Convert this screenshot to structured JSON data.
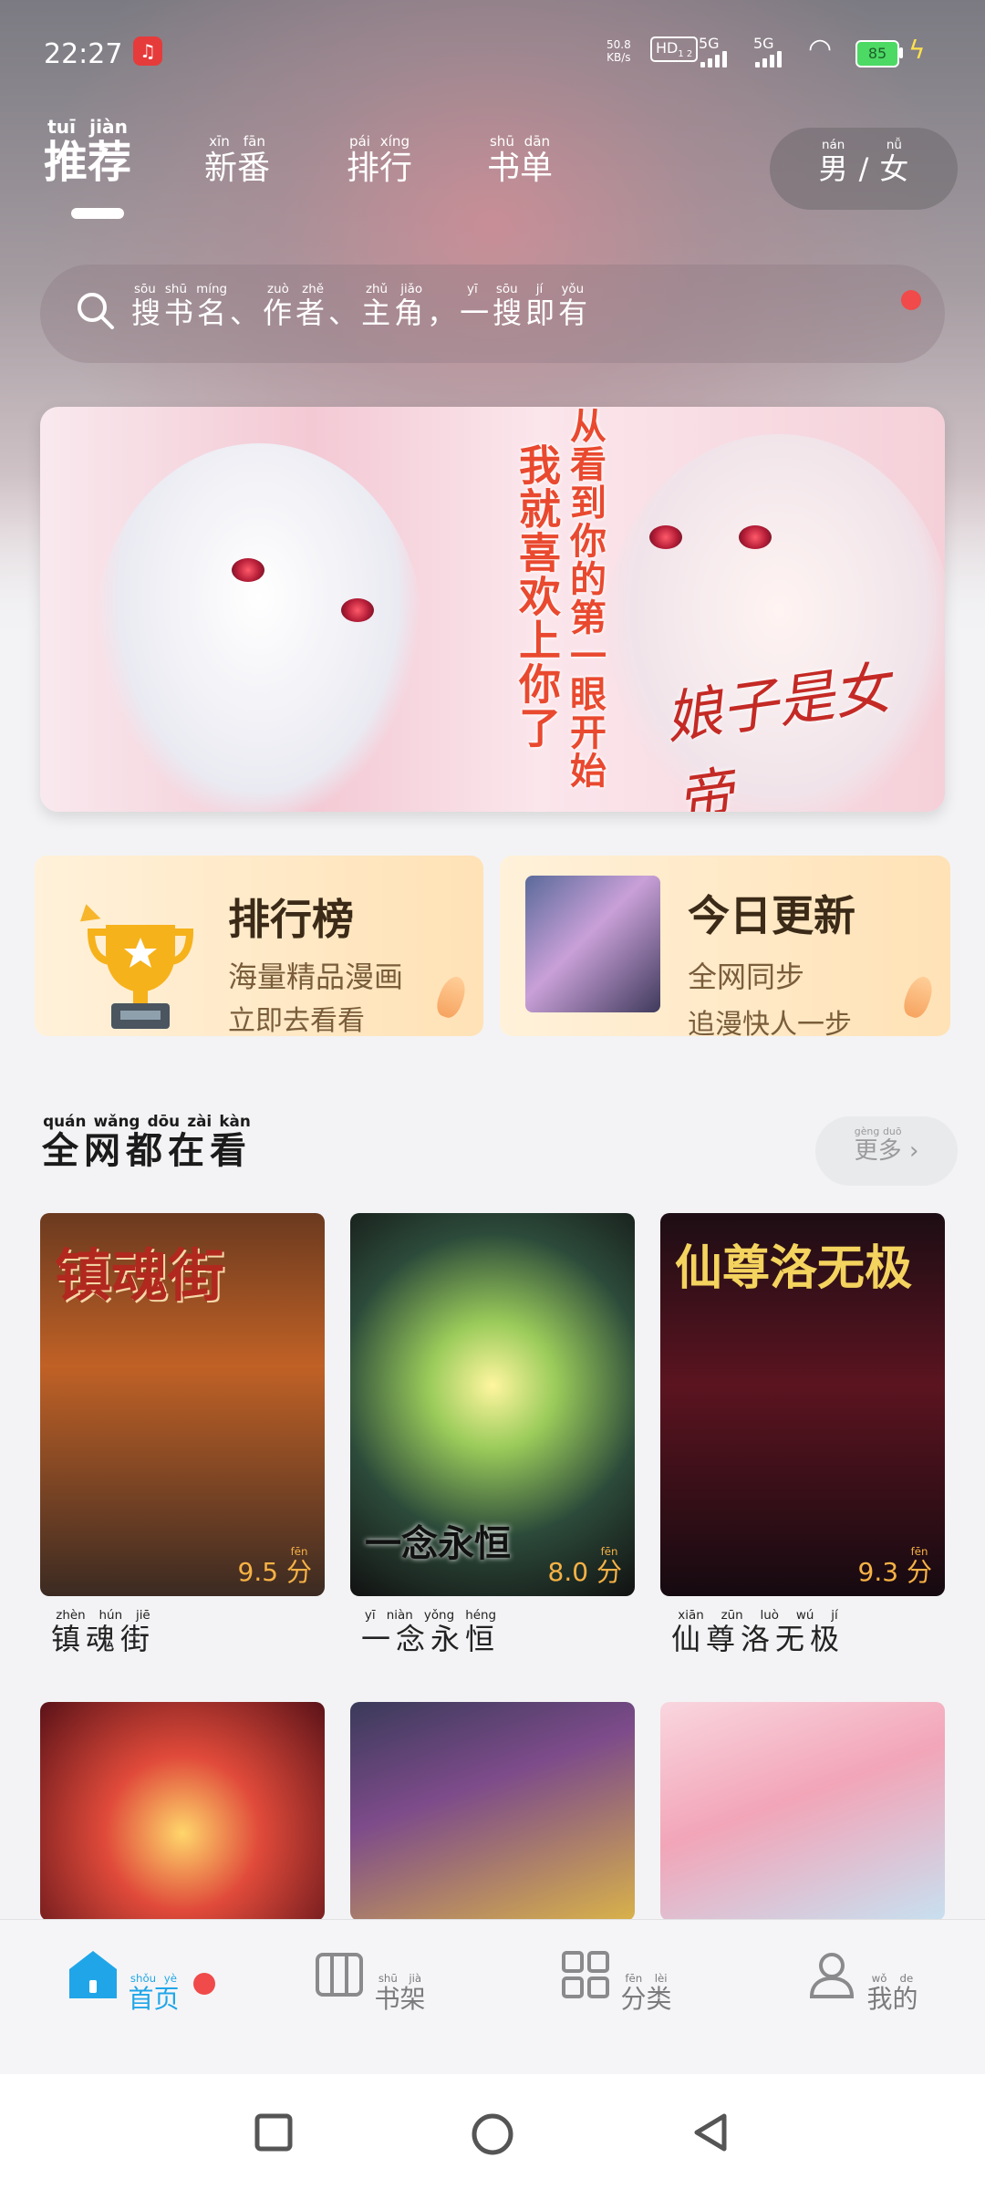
{
  "status_bar": {
    "time": "22:27",
    "net_speed_value": "50.8",
    "net_speed_unit": "KB/s",
    "hd_label": "HD",
    "hd_sub": "1 2",
    "sim1": "5G",
    "sim2": "5G",
    "battery": "85"
  },
  "top_tabs": [
    {
      "label": "推荐",
      "pinyin": "tuī jiàn"
    },
    {
      "label": "新番",
      "pinyin": "xīn fān"
    },
    {
      "label": "排行",
      "pinyin": "pái xíng"
    },
    {
      "label": "书单",
      "pinyin": "shū dān"
    }
  ],
  "gender_toggle": {
    "male": "男",
    "male_pinyin": "nán",
    "sep": "/",
    "female": "女",
    "female_pinyin": "nǚ"
  },
  "search": {
    "segments": [
      {
        "t": "搜书名",
        "p": "sōu shū míng"
      },
      {
        "t": "、",
        "p": ""
      },
      {
        "t": "作者",
        "p": "zuò zhě"
      },
      {
        "t": "、",
        "p": ""
      },
      {
        "t": "主角",
        "p": "zhǔ jiǎo"
      },
      {
        "t": "，",
        "p": ""
      },
      {
        "t": "一搜即有",
        "p": "yī sōu jí yǒu"
      }
    ]
  },
  "banner": {
    "line1": "我就喜欢上你了",
    "line2": "从看到你的第一眼开始",
    "logo": "娘子是女帝"
  },
  "feature_cards": {
    "rank": {
      "title": "排行榜",
      "line1": "海量精品漫画",
      "line2": "立即去看看"
    },
    "update": {
      "title": "今日更新",
      "line1": "全网同步",
      "line2": "追漫快人一步"
    }
  },
  "section": {
    "title": "全网都在看",
    "title_pinyin": "quán wǎng dōu zài kàn",
    "more": "更多",
    "more_pinyin": "gèng duō"
  },
  "comics": [
    {
      "cover_title": "镇魂街",
      "name": "镇魂街",
      "pinyin": "zhèn hún jiē",
      "score": "9.5",
      "score_unit": "分",
      "unit_pinyin": "fēn"
    },
    {
      "cover_title": "一念永恒",
      "name": "一念永恒",
      "pinyin": "yī niàn yǒng héng",
      "score": "8.0",
      "score_unit": "分",
      "unit_pinyin": "fēn"
    },
    {
      "cover_title": "仙尊洛无极",
      "name": "仙尊洛无极",
      "pinyin": "xiān zūn luò wú jí",
      "score": "9.3",
      "score_unit": "分",
      "unit_pinyin": "fēn"
    }
  ],
  "bottom_nav": [
    {
      "label": "首页",
      "pinyin": "shǒu yè"
    },
    {
      "label": "书架",
      "pinyin": "shū jià"
    },
    {
      "label": "分类",
      "pinyin": "fēn lèi"
    },
    {
      "label": "我的",
      "pinyin": "wǒ de"
    }
  ],
  "colors": {
    "accent": "#20a6e8",
    "badge": "#f04a4a",
    "score": "#f7b245"
  }
}
